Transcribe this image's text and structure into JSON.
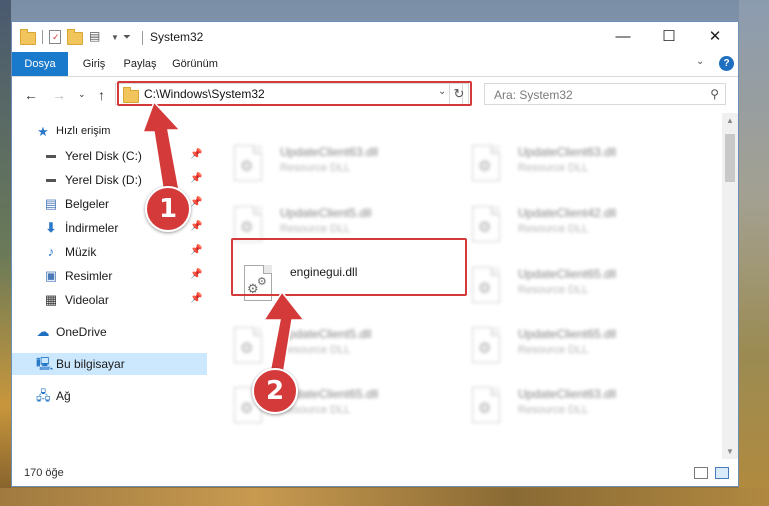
{
  "window": {
    "title": "System32",
    "buttons": {
      "minimize": "—",
      "maximize": "☐",
      "close": "✕"
    }
  },
  "ribbon": {
    "tabs": [
      "Dosya",
      "Giriş",
      "Paylaş",
      "Görünüm"
    ],
    "help": "?"
  },
  "address": {
    "path": "C:\\Windows\\System32",
    "search_placeholder": "Ara: System32"
  },
  "nav": {
    "items": [
      {
        "label": "Hızlı erişim",
        "icon": "star-icon",
        "pinned": false
      },
      {
        "label": "Yerel Disk (C:)",
        "icon": "drive-icon",
        "pinned": true
      },
      {
        "label": "Yerel Disk (D:)",
        "icon": "drive-icon",
        "pinned": true
      },
      {
        "label": "Belgeler",
        "icon": "documents-icon",
        "pinned": true
      },
      {
        "label": "İndirmeler",
        "icon": "download-icon",
        "pinned": true
      },
      {
        "label": "Müzik",
        "icon": "music-icon",
        "pinned": true
      },
      {
        "label": "Resimler",
        "icon": "pictures-icon",
        "pinned": true
      },
      {
        "label": "Videolar",
        "icon": "videos-icon",
        "pinned": true
      },
      {
        "label": "OneDrive",
        "icon": "cloud-icon",
        "pinned": false
      },
      {
        "label": "Bu bilgisayar",
        "icon": "computer-icon",
        "pinned": false,
        "selected": true
      },
      {
        "label": "Ağ",
        "icon": "network-icon",
        "pinned": false
      }
    ]
  },
  "files": [
    {
      "name": "UpdateClient63.dll",
      "type": "Resource DLL",
      "blurred": true
    },
    {
      "name": "UpdateClient63.dll",
      "type": "Resource DLL",
      "blurred": true
    },
    {
      "name": "UpdateClient5.dll",
      "type": "Resource DLL",
      "blurred": true
    },
    {
      "name": "UpdateClient42.dll",
      "type": "Resource DLL",
      "blurred": true
    },
    {
      "name": "enginegui.dll",
      "type": "",
      "blurred": false
    },
    {
      "name": "UpdateClient65.dll",
      "type": "Resource DLL",
      "blurred": true
    },
    {
      "name": "UpdateClient5.dll",
      "type": "Resource DLL",
      "blurred": true
    },
    {
      "name": "UpdateClient65.dll",
      "type": "Resource DLL",
      "blurred": true
    },
    {
      "name": "UpdateClient65.dll",
      "type": "Resource DLL",
      "blurred": true
    },
    {
      "name": "UpdateClient63.dll",
      "type": "Resource DLL",
      "blurred": true
    }
  ],
  "status": {
    "count": "170 öğe"
  },
  "annotations": {
    "step1": "1",
    "step2": "2",
    "color": "#d43a3a"
  }
}
